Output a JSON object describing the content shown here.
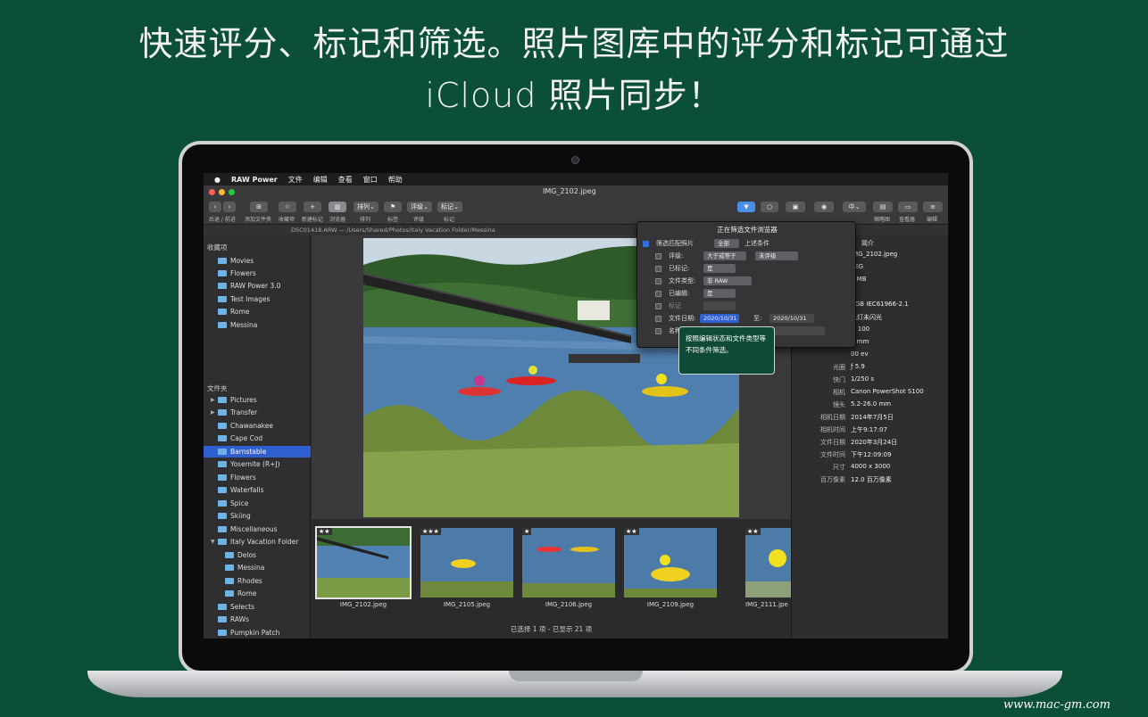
{
  "headline": {
    "line1": "快速评分、标记和筛选。照片图库中的评分和标记可通过",
    "line2": "iCloud 照片同步！"
  },
  "menubar": {
    "apple": "",
    "app": "RAW Power",
    "items": [
      "文件",
      "编辑",
      "查看",
      "窗口",
      "帮助"
    ]
  },
  "window": {
    "title": "IMG_2102.jpeg"
  },
  "toolbar": {
    "labels": {
      "nav": "后退 / 前进",
      "add_folder": "添加文件夹",
      "favorite": "收藏项",
      "new_tag": "新建标记",
      "browser": "浏览器",
      "sort": "排列",
      "tag": "标签",
      "rating": "评级",
      "mark": "标记",
      "thumb": "缩略图",
      "viewer": "查看器",
      "edit": "编辑"
    },
    "buttons": {
      "sort": "排列",
      "rating": "评级",
      "mark": "标记",
      "size": "中"
    }
  },
  "pathbar": "DSC01418.ARW  —  /Users/Shared/Photos/Italy Vacation Folder/Messina",
  "sidebar": {
    "favorites_title": "收藏项",
    "favorites": [
      "Movies",
      "Flowers",
      "RAW Power 3.0",
      "Test Images",
      "Rome",
      "Messina"
    ],
    "folders_title": "文件夹",
    "folders": [
      "Pictures",
      "Transfer",
      "Chawanakee",
      "Cape Cod",
      "Barnstable",
      "Yosemite (R+J)",
      "Flowers",
      "Waterfalls",
      "Spice",
      "Skiing",
      "Miscellaneous",
      "Italy Vacation Folder",
      "Delos",
      "Messina",
      "Rhodes",
      "Rome",
      "Selects",
      "RAWs",
      "Pumpkin Patch"
    ]
  },
  "filmstrip": {
    "thumbs": [
      {
        "name": "IMG_2102.jpeg",
        "stars": "★★"
      },
      {
        "name": "IMG_2105.jpeg",
        "stars": "★★★"
      },
      {
        "name": "IMG_2106.jpeg",
        "stars": "★"
      },
      {
        "name": "IMG_2109.jpeg",
        "stars": "★★"
      },
      {
        "name": "IMG_2111.jpe",
        "stars": "★★"
      }
    ],
    "status": "已选择 1 项 - 已显示 21 项"
  },
  "filter": {
    "title": "正在筛选文件浏览器",
    "match_label": "筛选匹配照片",
    "match_value": "全部",
    "match_suffix": "上述条件",
    "rating_label": "评级:",
    "rating_op": "大于或等于",
    "rating_val": "未评级",
    "tagged_label": "已标记:",
    "tagged_val": "是",
    "type_label": "文件类型:",
    "type_val": "非 RAW",
    "edited_label": "已编辑:",
    "edited_val": "是",
    "mark_label": "标记",
    "date_label": "文件日期:",
    "date_from": "2020/10/31",
    "date_to_label": "至:",
    "date_to": "2020/10/31",
    "name_label": "名称"
  },
  "tooltip": "按照编辑状态和文件类型等不同条件筛选。",
  "info": {
    "header": "简介",
    "rows": [
      {
        "k": "",
        "v": "IMG_2102.jpeg"
      },
      {
        "k": "",
        "v": "PEG"
      },
      {
        "k": "",
        "v": "8 MB"
      },
      {
        "k": "",
        "v": ""
      },
      {
        "k": "",
        "v": "RGB IEC61966-2.1"
      },
      {
        "k": "",
        "v": "光灯未闪光"
      },
      {
        "k": "",
        "v": "O 100"
      },
      {
        "k": "",
        "v": "5 mm"
      },
      {
        "k": "",
        "v": "00 ev"
      },
      {
        "k": "光圈",
        "v": "ƒ 5.9"
      },
      {
        "k": "快门",
        "v": "1/250 s"
      },
      {
        "k": "相机",
        "v": "Canon PowerShot S100"
      },
      {
        "k": "镜头",
        "v": "5.2-26.0 mm"
      },
      {
        "k": "相机日期",
        "v": "2014年7月5日"
      },
      {
        "k": "相机时间",
        "v": "上午9:17:07"
      },
      {
        "k": "文件日期",
        "v": "2020年3月24日"
      },
      {
        "k": "文件时间",
        "v": "下午12:09:09"
      },
      {
        "k": "尺寸",
        "v": "4000 x 3000"
      },
      {
        "k": "百万像素",
        "v": "12.0 百万像素"
      }
    ]
  },
  "watermark": "www.mac-gm.com"
}
